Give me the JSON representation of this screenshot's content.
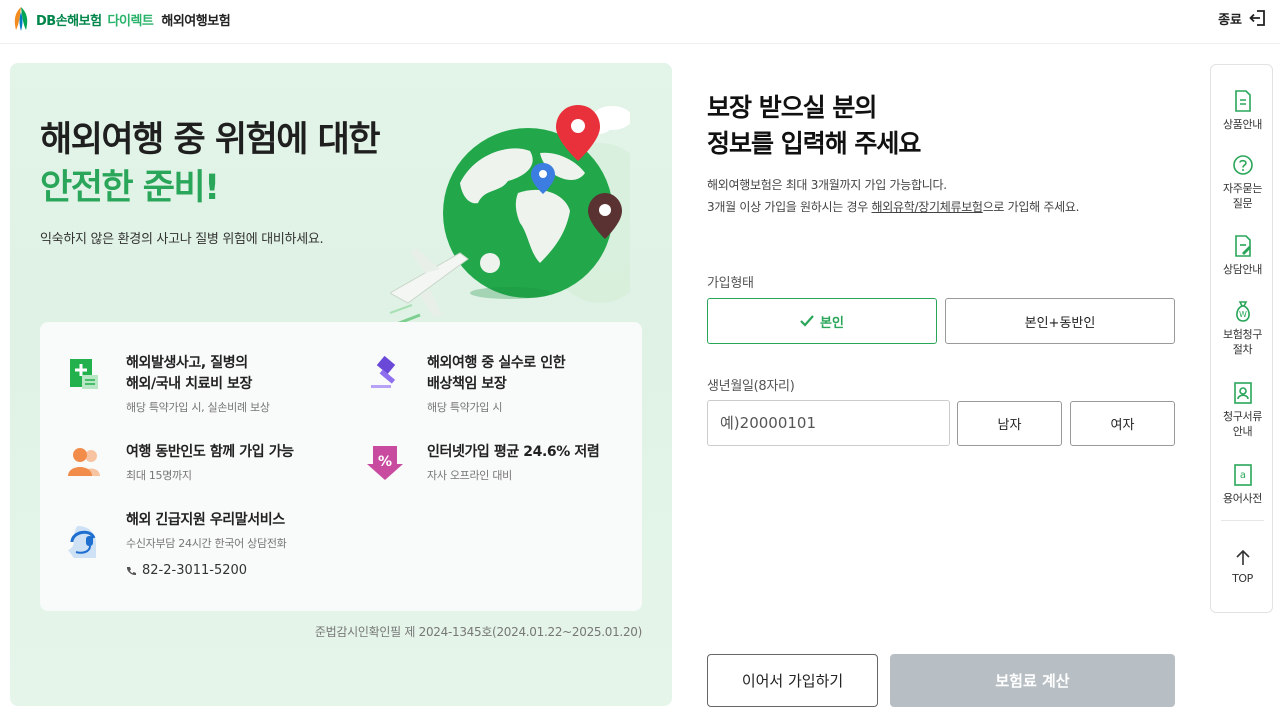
{
  "header": {
    "brand": "DB손해보험",
    "brand_sub": "다이렉트",
    "product": "해외여행보험",
    "exit_label": "종료"
  },
  "hero": {
    "title_line1": "해외여행 중 위험에 대한",
    "title_line2": "안전한 준비!",
    "description": "익숙하지 않은 환경의 사고나 질병 위험에 대비하세요.",
    "note": "준법감시인확인필 제 2024-1345호(2024.01.22~2025.01.20)"
  },
  "benefits": [
    {
      "icon": "medical-document-icon",
      "title": "해외발생사고, 질병의\n해외/국내 치료비 보장",
      "sub": "해당 특약가입 시, 실손비례 보상"
    },
    {
      "icon": "gavel-icon",
      "title": "해외여행 중 실수로 인한\n배상책임 보장",
      "sub": "해당 특약가입 시"
    },
    {
      "icon": "people-icon",
      "title": "여행 동반인도 함께 가입 가능",
      "sub": "최대 15명까지"
    },
    {
      "icon": "discount-icon",
      "title": "인터넷가입 평균 24.6% 저렴",
      "sub": "자사 오프라인 대비"
    },
    {
      "icon": "headset-icon",
      "title": "해외 긴급지원 우리말서비스",
      "sub": "수신자부담 24시간 한국어 상담전화",
      "phone": "82-2-3011-5200"
    }
  ],
  "form": {
    "title": "보장 받으실 분의\n정보를 입력해 주세요",
    "info_line1": "해외여행보험은 최대 3개월까지 가입 가능합니다.",
    "info_line2_pre": "3개월 이상 가입을 원하시는 경우 ",
    "info_line2_link": "해외유학/장기체류보험",
    "info_line2_post": "으로 가입해 주세요.",
    "type_label": "가입형태",
    "type_options": [
      "본인",
      "본인+동반인"
    ],
    "type_selected": "본인",
    "birth_label": "생년월일(8자리)",
    "birth_placeholder": "예)20000101",
    "gender_options": [
      "남자",
      "여자"
    ],
    "continue_label": "이어서 가입하기",
    "calc_label": "보험료 계산"
  },
  "sidebar": {
    "items": [
      {
        "icon": "document-icon",
        "label": "상품안내"
      },
      {
        "icon": "question-icon",
        "label": "자주묻는\n질문"
      },
      {
        "icon": "edit-document-icon",
        "label": "상담안내"
      },
      {
        "icon": "money-bag-icon",
        "label": "보험청구\n절차"
      },
      {
        "icon": "id-card-icon",
        "label": "청구서류\n안내"
      },
      {
        "icon": "dictionary-icon",
        "label": "용어사전"
      },
      {
        "icon": "arrow-up-icon",
        "label": "TOP"
      }
    ]
  },
  "colors": {
    "brand_green": "#00854a",
    "accent_green": "#2aa65a",
    "disabled_gray": "#b8bfc4"
  }
}
